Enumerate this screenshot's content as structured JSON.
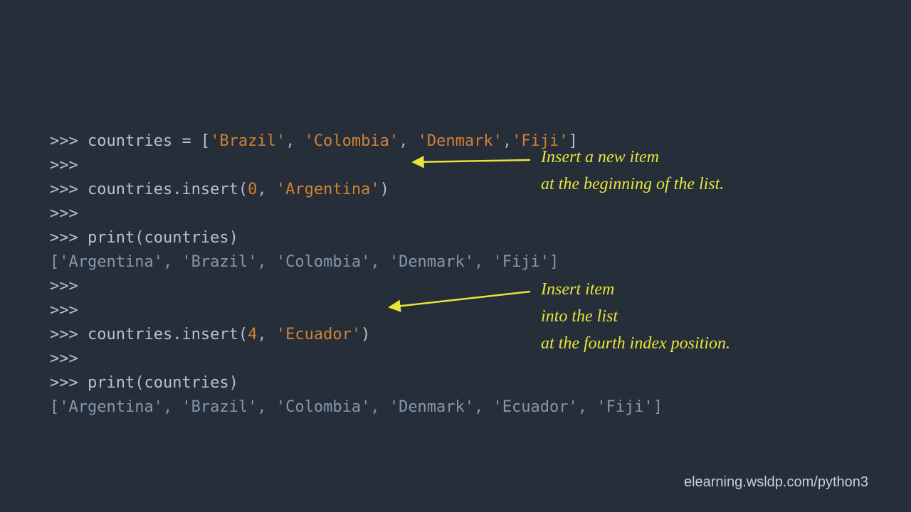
{
  "code": {
    "l1_prompt": ">>> ",
    "l1_a": "countries ",
    "l1_b": "= [",
    "l1_s1": "'Brazil'",
    "l1_c1": ", ",
    "l1_s2": "'Colombia'",
    "l1_c2": ", ",
    "l1_s3": "'Denmark'",
    "l1_c3": ",",
    "l1_s4": "'Fiji'",
    "l1_d": "]",
    "l2_prompt": ">>>",
    "l3_prompt": ">>> ",
    "l3_a": "countries.insert(",
    "l3_n": "0",
    "l3_c": ", ",
    "l3_s": "'Argentina'",
    "l3_d": ")",
    "l4_prompt": ">>>",
    "l5_prompt": ">>> ",
    "l5_a": "print(countries)",
    "l6_out": "['Argentina', 'Brazil', 'Colombia', 'Denmark', 'Fiji']",
    "l7_prompt": ">>>",
    "l8_prompt": ">>>",
    "l9_prompt": ">>> ",
    "l9_a": "countries.insert(",
    "l9_n": "4",
    "l9_c": ", ",
    "l9_s": "'Ecuador'",
    "l9_d": ")",
    "l10_prompt": ">>>",
    "l11_prompt": ">>> ",
    "l11_a": "print(countries)",
    "l12_out": "['Argentina', 'Brazil', 'Colombia', 'Denmark', 'Ecuador', 'Fiji']"
  },
  "annot1": {
    "line1": "Insert a new item",
    "line2": "at the beginning of the list."
  },
  "annot2": {
    "line1": "Insert item",
    "line2": "into the list",
    "line3": "at the fourth index position."
  },
  "footer": "elearning.wsldp.com/python3",
  "colors": {
    "annot": "#e7e53a",
    "arrow": "#e7e53a"
  }
}
